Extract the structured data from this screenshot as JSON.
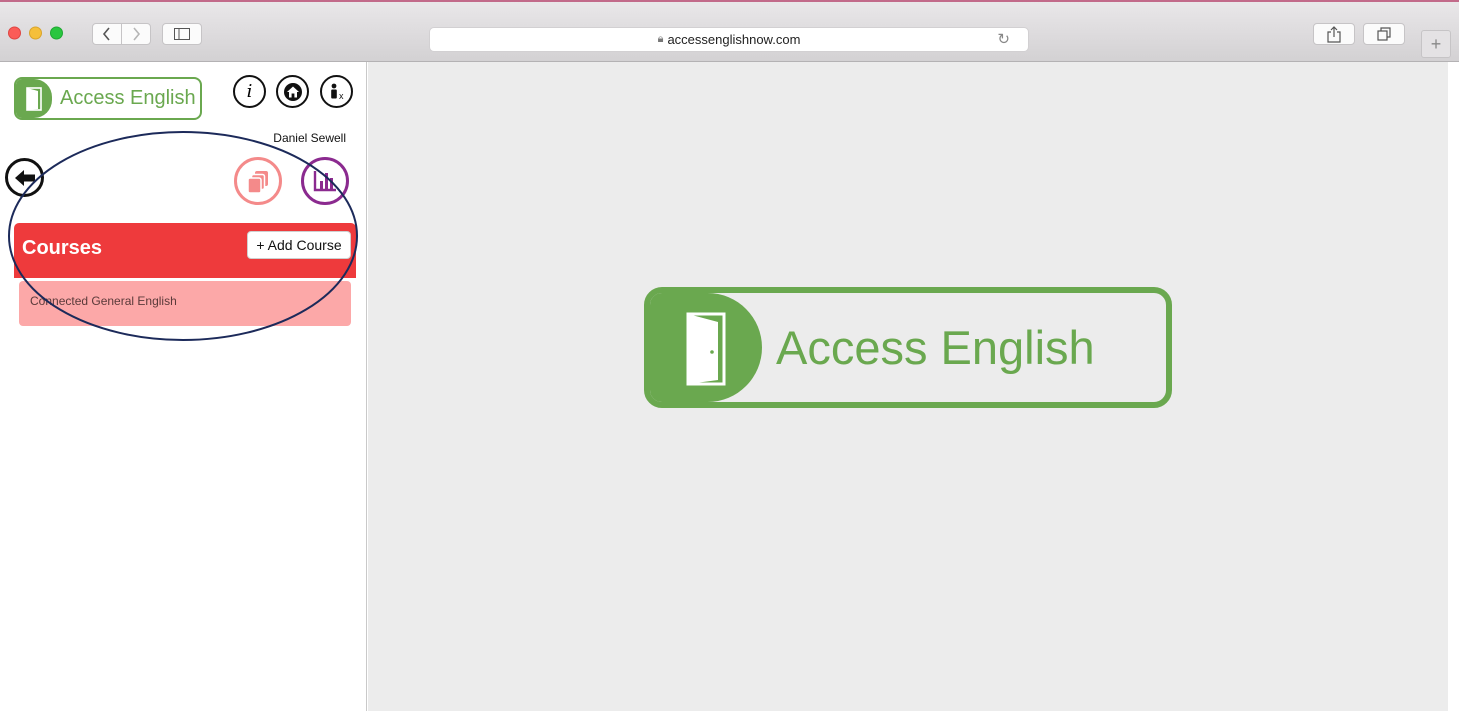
{
  "browser": {
    "url": "accessenglishnow.com",
    "lock_icon": "lock-icon",
    "reload_icon": "reload-icon",
    "back_icon": "chevron-left-icon",
    "forward_icon": "chevron-right-icon",
    "sidebar_icon": "sidebar-icon",
    "share_icon": "share-icon",
    "tabs_icon": "tabs-icon",
    "newtab_label": "+"
  },
  "sidebar": {
    "logo_text": "Access English",
    "user_name": "Daniel Sewell",
    "icons": [
      "info-icon",
      "home-icon",
      "accessibility-icon",
      "back-arrow-icon",
      "decks-icon",
      "stats-icon"
    ],
    "courses": {
      "title": "Courses",
      "add_button": "+ Add Course",
      "items": [
        {
          "label": "Connected General English"
        }
      ]
    }
  },
  "main": {
    "logo_text": "Access English"
  },
  "colors": {
    "brand_green": "#6aa84f",
    "courses_red": "#ee3a3c",
    "course_item_pink": "#fca8a8",
    "decks_pink": "#f48a8a",
    "stats_purple": "#8b2a8f",
    "annotation_navy": "#1c2a5a"
  }
}
